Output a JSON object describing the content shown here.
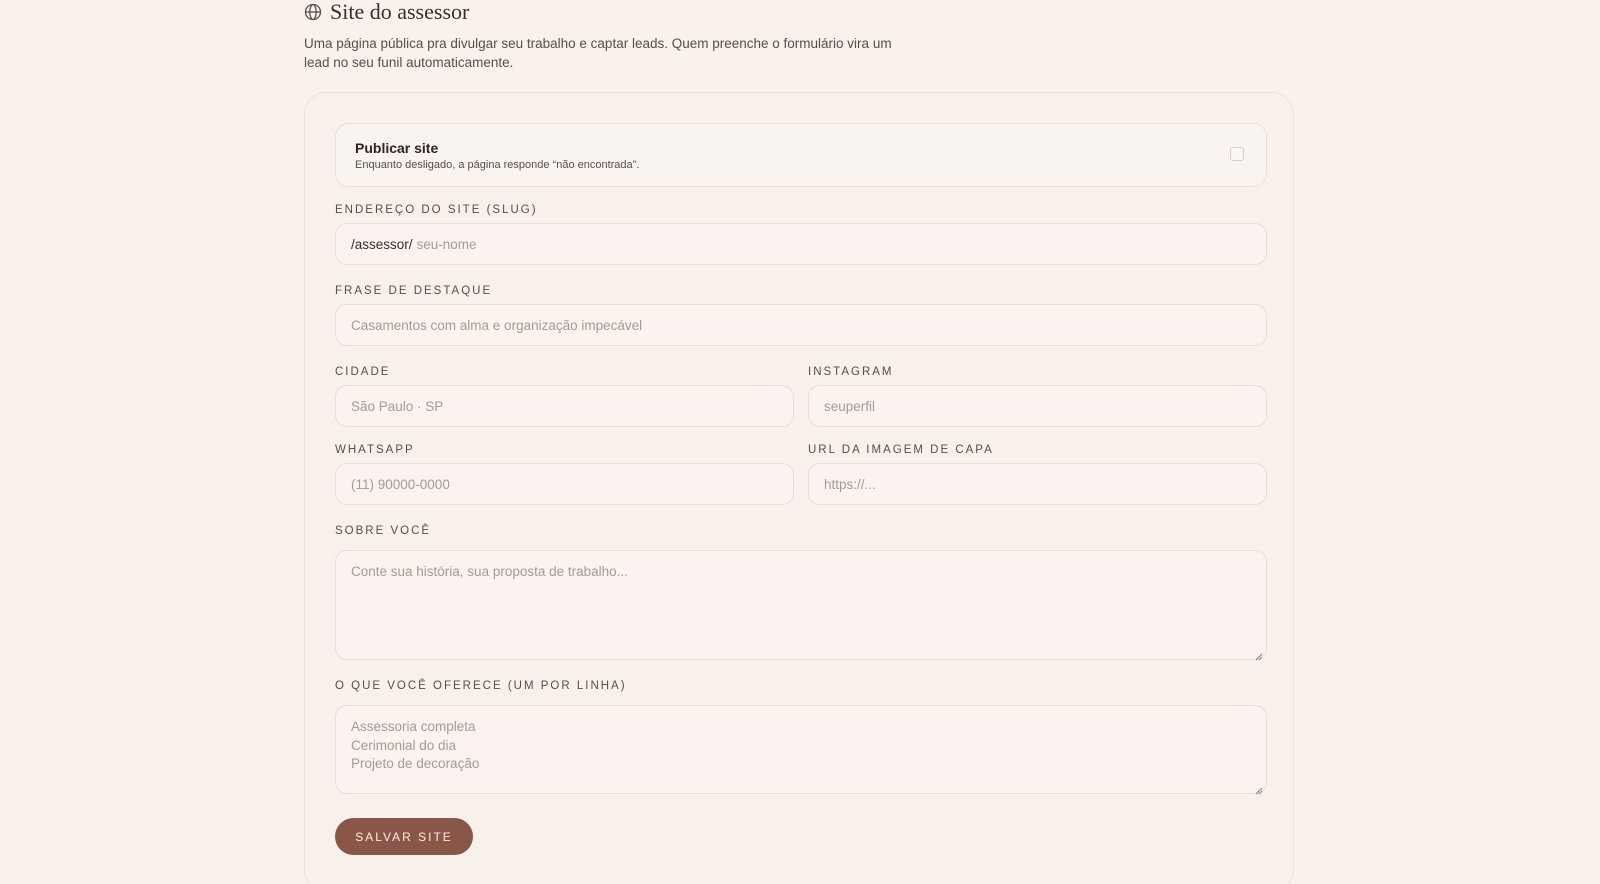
{
  "header": {
    "title": "Site do assessor",
    "subtitle": "Uma página pública pra divulgar seu trabalho e captar leads. Quem preenche o formulário vira um lead no seu funil automaticamente.",
    "icon": "globe-icon"
  },
  "publish": {
    "title": "Publicar site",
    "description": "Enquanto desligado, a página responde “não encontrada”.",
    "checked": false
  },
  "form": {
    "slug": {
      "label": "Endereço do site (slug)",
      "prefix": "/assessor/",
      "placeholder": "seu-nome",
      "value": ""
    },
    "tagline": {
      "label": "Frase de destaque",
      "placeholder": "Casamentos com alma e organização impecável",
      "value": ""
    },
    "city": {
      "label": "Cidade",
      "placeholder": "São Paulo · SP",
      "value": ""
    },
    "instagram": {
      "label": "Instagram",
      "placeholder": "seuperfil",
      "value": ""
    },
    "whatsapp": {
      "label": "WhatsApp",
      "placeholder": "(11) 90000-0000",
      "value": ""
    },
    "cover_url": {
      "label": "URL da imagem de capa",
      "placeholder": "https://...",
      "value": ""
    },
    "about": {
      "label": "Sobre você",
      "placeholder": "Conte sua história, sua proposta de trabalho...",
      "value": ""
    },
    "offers": {
      "label": "O que você oferece (um por linha)",
      "placeholder_lines": [
        "Assessoria completa",
        "Cerimonial do dia",
        "Projeto de decoração"
      ],
      "value": ""
    }
  },
  "actions": {
    "save_label": "Salvar site"
  },
  "colors": {
    "background": "#f8f1ec",
    "accent": "#8a5648",
    "text": "#3a2e2a"
  }
}
